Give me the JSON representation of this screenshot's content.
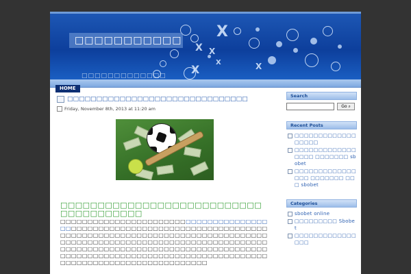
{
  "header": {
    "site_title": "□□□□□□□□□□□",
    "tagline": "□□□□□□□□□□□□□"
  },
  "nav": {
    "home_label": "HOME"
  },
  "post": {
    "title": "□□□□□□□□□□□□□□□□□□□□□□□□□□□□□□□",
    "date": "Friday, November 8th, 2013 at 11:20 am",
    "heading": "□□□□□□□□□□□□□□□□□□□□□□□□□□□□□□□□□□□□□□",
    "body_lead": "□□□□□□□□□□□□□□□□□□□□□□□",
    "body_link": "□□□□□□□□□□□□□□□□□",
    "body_rest": "□□□□□□□□□□□□□□□□□□□□□□□□□□□□□□□□□□□□□□□□□□□□□□□□□□□□□□□□□□□□□□□□□□□□□□□□□□□□□□□□□□□□□□□□□□□□□□□□□□□□□□□□□□□□□□□□□□□□□□□□□□□□□□□□□□□□□□□□□□□□□□□□□□□□□□□□□□□□□□□□□□□□□□□□□□□□□□□□□□□□□□□□□□□□□□□□□□□□□□□□□□□□□□□□□□□□□□□"
  },
  "sidebar": {
    "search": {
      "title": "Search",
      "placeholder": "",
      "button_label": "Go"
    },
    "recent_posts": {
      "title": "Recent Posts",
      "items": [
        "□□□□□□□□□□□□□□□□□□",
        "□□□□□□□□□□□□□□□□□ □□□□□□□ sbobet",
        "□□□□□□□□□□□□□□□□ □□□□□□□ □□□ sbobet"
      ]
    },
    "categories": {
      "title": "Categories",
      "items": [
        "sbobet online",
        "□□□□□□□□□ Sbobet",
        "□□□□□□□□□□□□□□□□"
      ]
    }
  },
  "colors": {
    "page_bg": "#333333",
    "header_blue": "#0d3f9c",
    "link": "#2a5eb0",
    "heading_green": "#2c9a2c",
    "nav_active": "#0d2f73"
  }
}
